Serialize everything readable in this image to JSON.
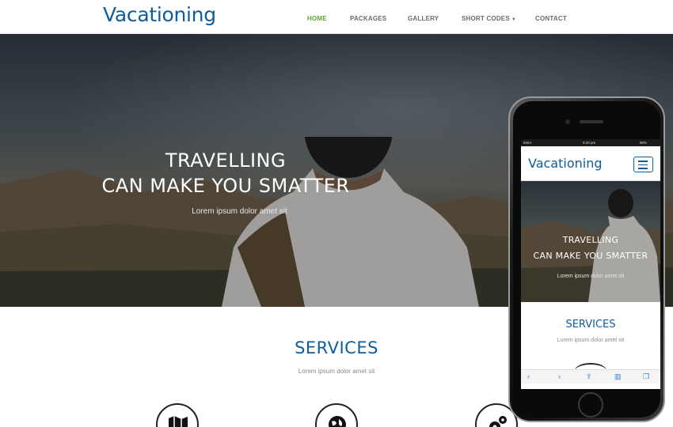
{
  "brand": {
    "logo": "Vacationing",
    "accent_color": "#0f5d9a",
    "active_nav_color": "#5aa62a"
  },
  "nav": {
    "items": [
      {
        "label": "HOME",
        "active": true
      },
      {
        "label": "PACKAGES",
        "active": false
      },
      {
        "label": "GALLERY",
        "active": false
      },
      {
        "label": "SHORT CODES",
        "active": false,
        "dropdown": true
      },
      {
        "label": "CONTACT",
        "active": false
      }
    ]
  },
  "hero": {
    "title_line1": "TRAVELLING",
    "title_line2": "CAN MAKE YOU SMATTER",
    "subtitle": "Lorem ipsum dolor amet sit"
  },
  "services": {
    "title": "SERVICES",
    "subtitle": "Lorem ipsum dolor amet sit",
    "icons": [
      "map-icon",
      "globe-icon",
      "gears-icon"
    ]
  },
  "phone": {
    "status": {
      "carrier": "IDEA",
      "time": "9:20 pm",
      "battery": "90%"
    },
    "logo": "Vacationing",
    "hero_title_line1": "TRAVELLING",
    "hero_title_line2": "CAN MAKE YOU SMATTER",
    "hero_subtitle": "Lorem ipsum dolor amet sit",
    "services_title": "SERVICES",
    "services_subtitle": "Lorem ipsum dolor amet sit",
    "browser_icons": [
      "back-icon",
      "forward-icon",
      "share-icon",
      "bookmarks-icon",
      "tabs-icon"
    ]
  }
}
